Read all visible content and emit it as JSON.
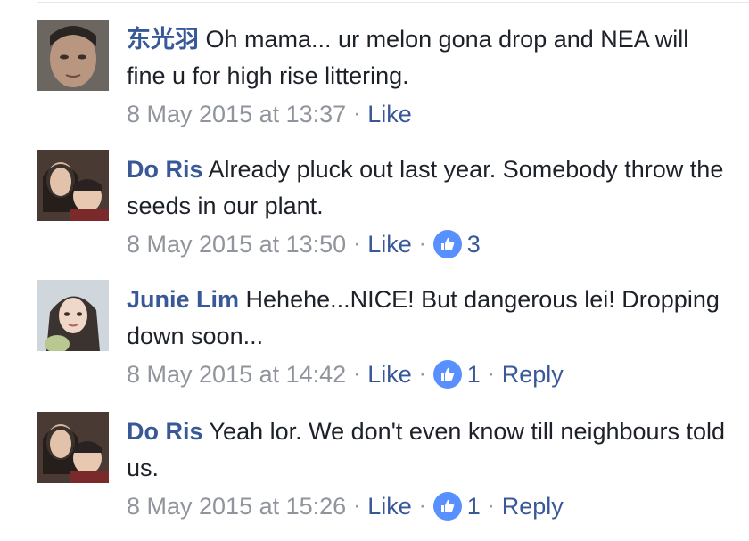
{
  "comments": [
    {
      "author": "东光羽",
      "text": "Oh mama... ur melon gona drop and NEA will fine u for high rise littering.",
      "timestamp": "8 May 2015 at 13:37",
      "like_label": "Like",
      "reactions": null,
      "reply_label": null
    },
    {
      "author": "Do Ris",
      "text": "Already pluck out last year. Somebody throw the seeds in our plant.",
      "timestamp": "8 May 2015 at 13:50",
      "like_label": "Like",
      "reactions": "3",
      "reply_label": null
    },
    {
      "author": "Junie Lim",
      "text": "Hehehe...NICE! But dangerous lei! Dropping down soon...",
      "timestamp": "8 May 2015 at 14:42",
      "like_label": "Like",
      "reactions": "1",
      "reply_label": "Reply"
    },
    {
      "author": "Do Ris",
      "text": "Yeah lor. We don't even know till neighbours told us.",
      "timestamp": "8 May 2015 at 15:26",
      "like_label": "Like",
      "reactions": "1",
      "reply_label": "Reply"
    }
  ],
  "separator": "·",
  "colors": {
    "link": "#385898",
    "meta": "#90949c",
    "text": "#1d2129",
    "like_badge": "#5890ff"
  },
  "icons": {
    "reaction": "thumbs-up-icon"
  }
}
